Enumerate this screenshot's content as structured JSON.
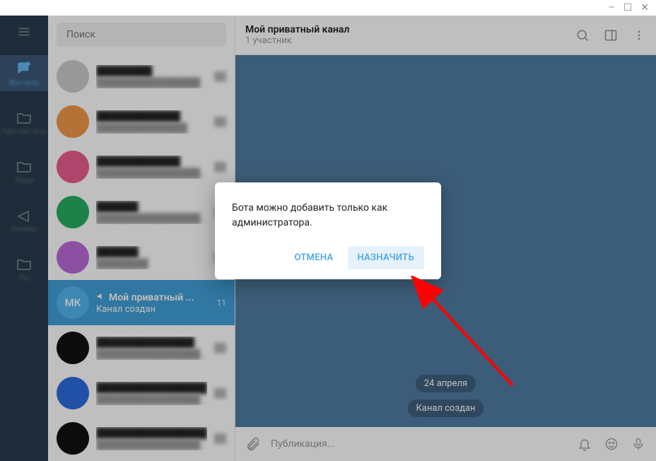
{
  "window_controls": {
    "min": "–",
    "max": "☐",
    "close": "✕"
  },
  "search": {
    "placeholder": "Поиск"
  },
  "rail": {
    "items": [
      {
        "label": "Все чаты",
        "active": true
      },
      {
        "label": "Рабочие чаты"
      },
      {
        "label": "Люди"
      },
      {
        "label": "Каналы"
      },
      {
        "label": "Pro"
      }
    ]
  },
  "chats": {
    "selected": {
      "avatar_text": "МК",
      "avatar_color": "#54b4ef",
      "title": "Мой приватный ...",
      "time": "11",
      "subtitle": "Канал создан"
    },
    "placeholders": [
      {
        "color": "#cccccc"
      },
      {
        "color": "#f2994a"
      },
      {
        "color": "#eb5c8f"
      },
      {
        "color": "#27ae60"
      },
      {
        "color": "#bb6bd9"
      }
    ],
    "placeholders_after": [
      {
        "color": "#111111"
      },
      {
        "color": "#2d6cdf"
      },
      {
        "color": "#111111"
      }
    ]
  },
  "header": {
    "title": "Мой приватный канал",
    "subtitle": "1 участник"
  },
  "chat_body": {
    "date_pill": "24 апреля",
    "service_pill": "Канал создан"
  },
  "composer": {
    "placeholder": "Публикация..."
  },
  "dialog": {
    "message": "Бота можно добавить только как администратора.",
    "cancel": "ОТМЕНА",
    "confirm": "НАЗНАЧИТЬ"
  }
}
